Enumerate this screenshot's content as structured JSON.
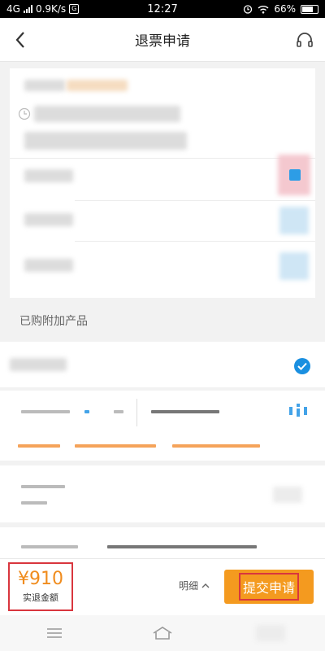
{
  "status_bar": {
    "network": "4G",
    "speed": "0.9K/s",
    "carrier_badge": "G",
    "time": "12:27",
    "battery": "66%",
    "icons": [
      "signal-icon",
      "alarm-icon",
      "wifi-icon",
      "battery-icon"
    ]
  },
  "header": {
    "title": "退票申请",
    "back_icon": "chevron-left-icon",
    "service_icon": "headphones-icon"
  },
  "addons": {
    "section_label": "已购附加产品"
  },
  "footer": {
    "refund_amount": "¥910",
    "refund_label": "实退金额",
    "detail_label": "明细",
    "submit_label": "提交申请"
  },
  "colors": {
    "accent_orange": "#f49a1f",
    "price_orange": "#f08c1e",
    "highlight_red": "#d9363e",
    "check_blue": "#1a8fe0"
  }
}
